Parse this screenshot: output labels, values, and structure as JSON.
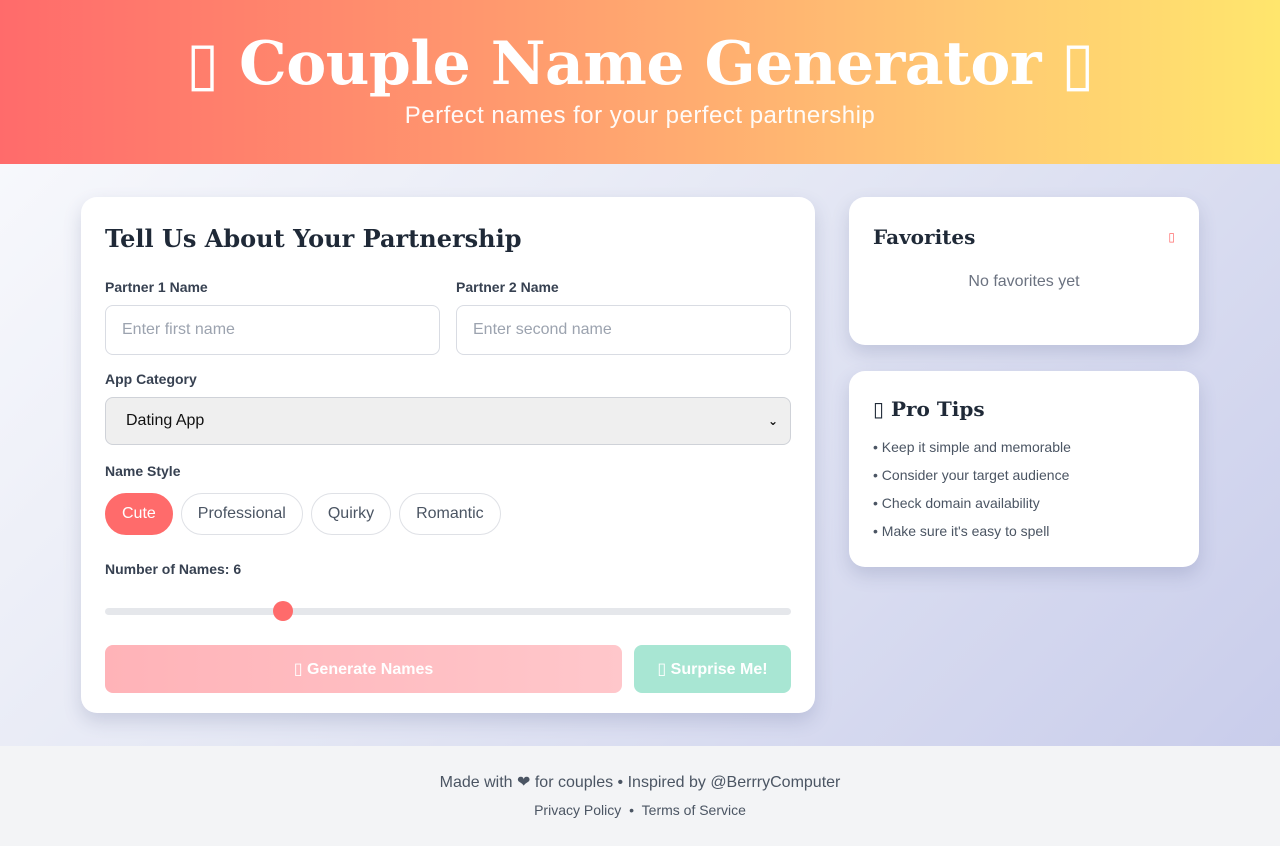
{
  "header": {
    "title_icon_left": "▯",
    "title": "Couple Name Generator",
    "title_icon_right": "▯",
    "subtitle": "Perfect names for your perfect partnership"
  },
  "form": {
    "title": "Tell Us About Your Partnership",
    "partner1": {
      "label": "Partner 1 Name",
      "placeholder": "Enter first name"
    },
    "partner2": {
      "label": "Partner 2 Name",
      "placeholder": "Enter second name"
    },
    "category": {
      "label": "App Category",
      "selected": "Dating App"
    },
    "style": {
      "label": "Name Style",
      "options": [
        "Cute",
        "Professional",
        "Quirky",
        "Romantic"
      ],
      "active": "Cute"
    },
    "count": {
      "label": "Number of Names: 6",
      "value": 6,
      "fraction": 0.26
    },
    "generate_label": "▯ Generate Names",
    "surprise_label": "▯ Surprise Me!"
  },
  "favorites": {
    "title": "Favorites",
    "icon": "▯",
    "empty_text": "No favorites yet"
  },
  "tips": {
    "title": "▯ Pro Tips",
    "items": [
      "• Keep it simple and memorable",
      "• Consider your target audience",
      "• Check domain availability",
      "• Make sure it's easy to spell"
    ]
  },
  "footer": {
    "line": "Made with ❤ for couples • Inspired by @BerrryComputer",
    "privacy": "Privacy Policy",
    "separator": "•",
    "terms": "Terms of Service"
  },
  "colors": {
    "accent": "#ff6b6b",
    "surprise": "#a8e6d3"
  }
}
